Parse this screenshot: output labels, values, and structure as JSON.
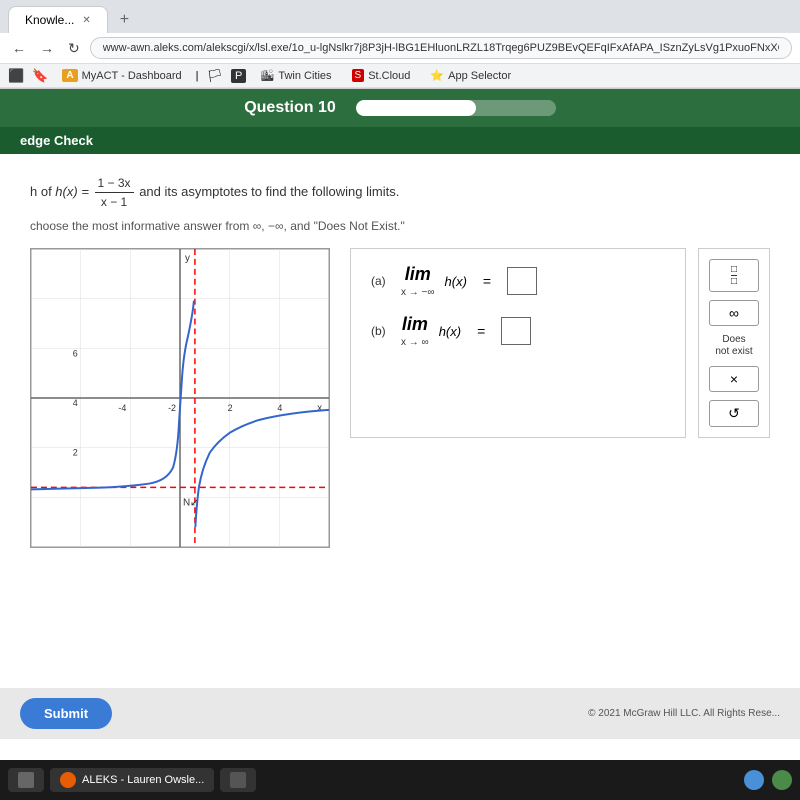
{
  "browser": {
    "tab_title": "Knowle...",
    "new_tab_label": "+",
    "address": "www-awn.aleks.com/alekscgi/x/lsl.exe/1o_u-lgNslkr7j8P3jH-lBG1EHluonLRZL18Trqeg6PUZ9BEvQEFqIFxAfAPA_ISznZyLsVg1PxuoFNxXOAd",
    "bookmarks": [
      {
        "label": "MyACT - Dashboard",
        "icon": "A"
      },
      {
        "label": "Twin Cities",
        "icon": "T"
      },
      {
        "label": "St.Cloud",
        "icon": "S"
      },
      {
        "label": "App Selector",
        "icon": "★"
      }
    ]
  },
  "header": {
    "question_label": "Question 10",
    "progress": 60,
    "section_title": "edge Check"
  },
  "problem": {
    "description_start": "h of",
    "function_label": "h(x) =",
    "function_numerator": "1 − 3x",
    "function_denominator": "x − 1",
    "description_end": "and its asymptotes to find the following limits.",
    "instruction": "choose the most informative answer from ∞, −∞, and \"Does Not Exist.\""
  },
  "limits": {
    "part_a": {
      "label": "(a)",
      "lim_text": "lim",
      "subscript": "x → −∞",
      "expr": "h(x)",
      "equals": "="
    },
    "part_b": {
      "label": "(b)",
      "lim_text": "lim",
      "subscript": "x → ∞",
      "expr": "h(x)",
      "equals": "="
    }
  },
  "options": {
    "fraction_icon": "□/□",
    "infinity_icon": "∞",
    "does_not_exist": "Does\nnot exist",
    "times_icon": "×",
    "undo_icon": "↺"
  },
  "footer": {
    "submit_label": "Submit",
    "copyright": "© 2021 McGraw Hill LLC. All Rights Rese..."
  },
  "taskbar": {
    "file_explorer": "File Explorer",
    "aleks_tab": "ALEKS - Lauren Owsle...",
    "extra_item": ""
  }
}
